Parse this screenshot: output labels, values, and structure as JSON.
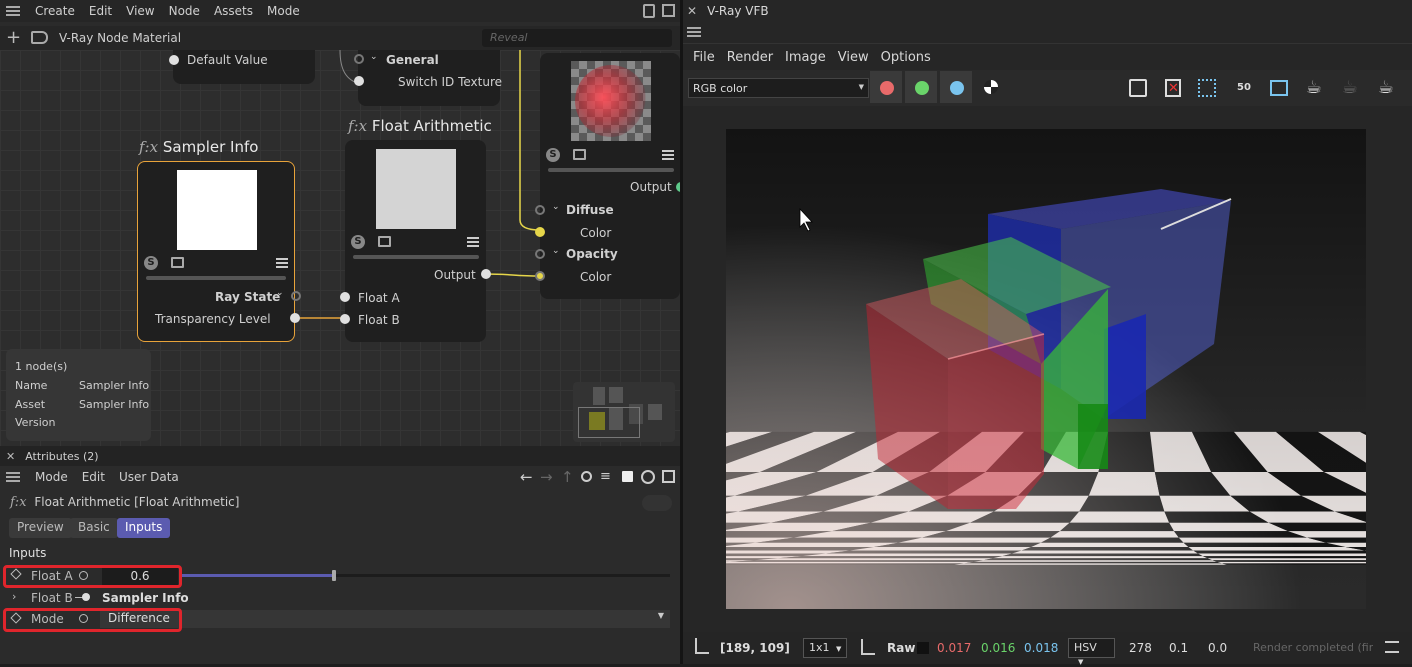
{
  "left_menu": {
    "items": [
      "Create",
      "Edit",
      "View",
      "Node",
      "Assets",
      "Mode"
    ]
  },
  "breadcrumb": {
    "title": "V-Ray Node Material",
    "reveal_placeholder": "Reveal"
  },
  "nodes": {
    "default_value_label": "Default Value",
    "general": {
      "section": "General",
      "port": "Switch ID Texture"
    },
    "sampler_info": {
      "fx": "f:x",
      "title": "Sampler Info",
      "port_ray_state": "Ray State",
      "port_transparency": "Transparency Level"
    },
    "float_arithmetic": {
      "fx": "f:x",
      "title": "Float Arithmetic",
      "output": "Output",
      "in_a": "Float A",
      "in_b": "Float B"
    },
    "material": {
      "output": "Output",
      "diffuse": "Diffuse",
      "diffuse_color": "Color",
      "opacity": "Opacity",
      "opacity_color": "Color"
    }
  },
  "info_panel": {
    "count": "1 node(s)",
    "name_label": "Name",
    "name_value": "Sampler Info",
    "asset_label": "Asset",
    "asset_value": "Sampler Info",
    "version_label": "Version"
  },
  "attributes": {
    "header": "Attributes (2)",
    "menu": [
      "Mode",
      "Edit",
      "User Data"
    ],
    "object_fx": "f:x",
    "object_title": "Float Arithmetic [Float Arithmetic]",
    "tabs": [
      "Preview",
      "Basic",
      "Inputs"
    ],
    "section": "Inputs",
    "float_a_label": "Float A",
    "float_a_value": "0.6",
    "float_a_level": 0.6,
    "float_b_label": "Float B",
    "float_b_value": "Sampler Info",
    "mode_label": "Mode",
    "mode_value": "Difference"
  },
  "vfb": {
    "title": "V-Ray VFB",
    "menu": [
      "File",
      "Render",
      "Image",
      "View",
      "Options"
    ],
    "channel": "RGB color",
    "status": {
      "coords": "[189, 109]",
      "zoom": "1x1",
      "raw_label": "Raw",
      "r": "0.017",
      "g": "0.016",
      "b": "0.018",
      "color_mode": "HSV",
      "h": "278",
      "s": "0.1",
      "v": "0.0",
      "message": "Render completed (fini"
    }
  },
  "colors": {
    "accent": "#5b5bb0",
    "highlight": "#e0252c",
    "wire_yellow": "#e6d64a",
    "sampler_border": "#e8a33a"
  }
}
